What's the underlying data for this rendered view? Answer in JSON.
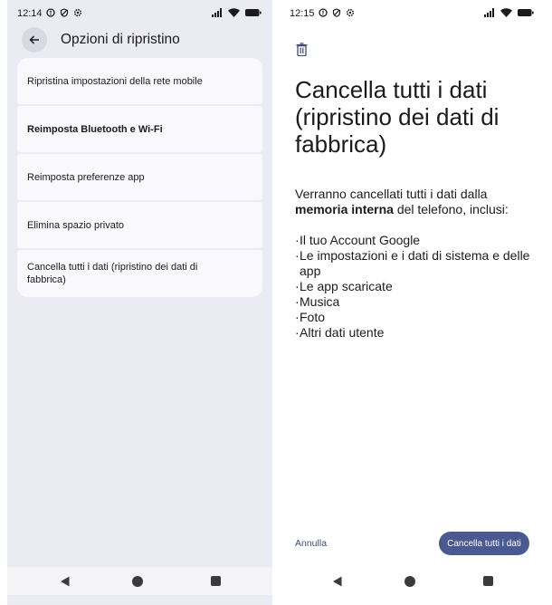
{
  "left": {
    "status": {
      "time": "12:14"
    },
    "title": "Opzioni di ripristino",
    "options": [
      {
        "label": "Ripristina impostazioni della rete mobile"
      },
      {
        "label": "Reimposta Bluetooth e Wi-Fi"
      },
      {
        "label": "Reimposta preferenze app"
      },
      {
        "label": "Elimina spazio privato"
      },
      {
        "label": "Cancella tutti i dati (ripristino dei dati di fabbrica)"
      }
    ]
  },
  "right": {
    "status": {
      "time": "12:15"
    },
    "title": "Cancella tutti i dati (ripristino dei dati di fabbrica)",
    "intro_before": "Verranno cancellati tutti i dati dalla ",
    "intro_bold": "memoria interna",
    "intro_after": " del telefono, inclusi:",
    "items": [
      "Il tuo Account Google",
      "Le impostazioni e i dati di sistema e delle app",
      "Le app scaricate",
      "Musica",
      "Foto",
      "Altri dati utente"
    ],
    "cancel_label": "Annulla",
    "confirm_label": "Cancella tutti i dati"
  },
  "colors": {
    "left_bg": "#ebebf3",
    "card_bg": "#f9f8fd",
    "accent": "#4a5a91"
  },
  "icons": {
    "status": [
      "alert-circle-icon",
      "shield-icon",
      "settings-icon",
      "signal-icon",
      "wifi-icon",
      "battery-icon"
    ],
    "nav": [
      "nav-back-icon",
      "nav-home-icon",
      "nav-recents-icon"
    ],
    "back": "arrow-left-icon",
    "trash": "trash-icon"
  }
}
